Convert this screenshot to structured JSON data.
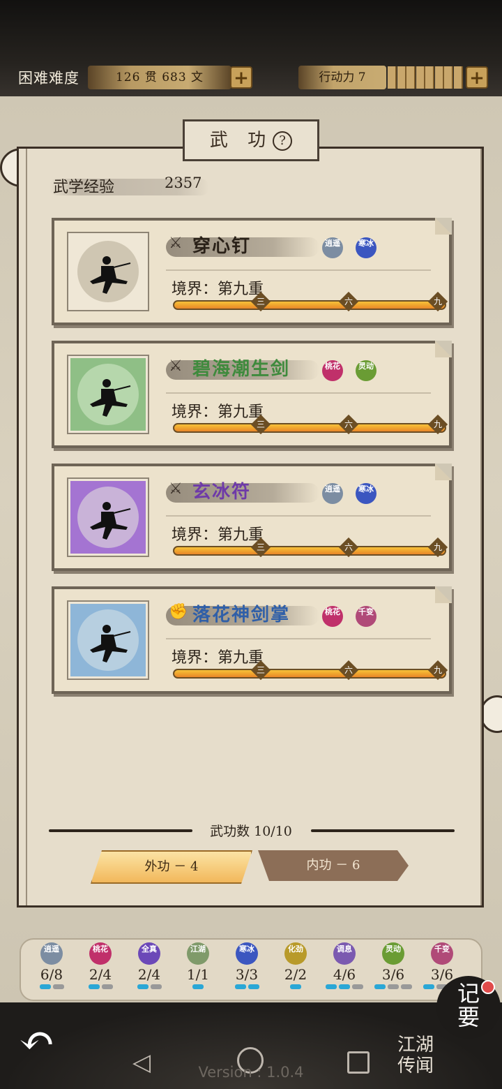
{
  "header": {
    "difficulty": "困难难度",
    "money": "126 贯 683 文",
    "energy": "行动力 7",
    "energy_segments": 8,
    "plus_label": "+"
  },
  "title": {
    "text": "武 功",
    "help": "?"
  },
  "experience": {
    "label": "武学经验",
    "value": "2357"
  },
  "skills": [
    {
      "name": "穿心钉",
      "weapon_icon": "dart-icon",
      "name_color": "#2a2118",
      "portrait_color": "#efe7d6",
      "disc_color": "#cfc6b2",
      "realm": "境界：第九重",
      "progress": 1.0,
      "badges": [
        {
          "text": "逍遥",
          "color": "#7c8da2"
        },
        {
          "text": "寒冰",
          "color": "#3b56c0"
        }
      ]
    },
    {
      "name": "碧海潮生剑",
      "weapon_icon": "sword-icon",
      "name_color": "#3f8a3d",
      "portrait_color": "#8fbf86",
      "disc_color": "#b6d7ac",
      "realm": "境界：第九重",
      "progress": 1.0,
      "badges": [
        {
          "text": "桃花",
          "color": "#c0306a"
        },
        {
          "text": "灵动",
          "color": "#6a9c34"
        }
      ]
    },
    {
      "name": "玄冰符",
      "weapon_icon": "dart-icon",
      "name_color": "#6e3aa8",
      "portrait_color": "#a474d2",
      "disc_color": "#c9b3d8",
      "realm": "境界：第九重",
      "progress": 1.0,
      "badges": [
        {
          "text": "逍遥",
          "color": "#7c8da2"
        },
        {
          "text": "寒冰",
          "color": "#3b56c0"
        }
      ]
    },
    {
      "name": "落花神剑掌",
      "weapon_icon": "fist-icon",
      "name_color": "#2f5fa8",
      "portrait_color": "#8eb6d8",
      "disc_color": "#b7cfe0",
      "realm": "境界：第九重",
      "progress": 1.0,
      "badges": [
        {
          "text": "桃花",
          "color": "#c0306a"
        },
        {
          "text": "千变",
          "color": "#b04a78"
        }
      ]
    }
  ],
  "progress_ticks": [
    "三",
    "六",
    "九"
  ],
  "skill_count": "武功数 10/10",
  "tabs": {
    "external": "外功 － 4",
    "internal": "内功 － 6"
  },
  "tags": [
    {
      "text": "逍遥",
      "color": "#7c8da2",
      "count": "6/8",
      "on": 1,
      "total": 2
    },
    {
      "text": "桃花",
      "color": "#c0306a",
      "count": "2/4",
      "on": 1,
      "total": 2
    },
    {
      "text": "全真",
      "color": "#6b48b8",
      "count": "2/4",
      "on": 1,
      "total": 2
    },
    {
      "text": "江湖",
      "color": "#7f9a6a",
      "count": "1/1",
      "on": 1,
      "total": 1
    },
    {
      "text": "寒冰",
      "color": "#3b56c0",
      "count": "3/3",
      "on": 2,
      "total": 2
    },
    {
      "text": "化劲",
      "color": "#b89a2a",
      "count": "2/2",
      "on": 1,
      "total": 1
    },
    {
      "text": "调息",
      "color": "#7b5ab0",
      "count": "4/6",
      "on": 2,
      "total": 3
    },
    {
      "text": "灵动",
      "color": "#6a9c34",
      "count": "3/6",
      "on": 1,
      "total": 3
    },
    {
      "text": "千变",
      "color": "#b04a78",
      "count": "3/6",
      "on": 1,
      "total": 3
    }
  ],
  "bottom": {
    "back_icon": "back-arrow-icon",
    "version": "Version : 1.0.4",
    "notes": "记要",
    "news": "江湖传闻"
  }
}
